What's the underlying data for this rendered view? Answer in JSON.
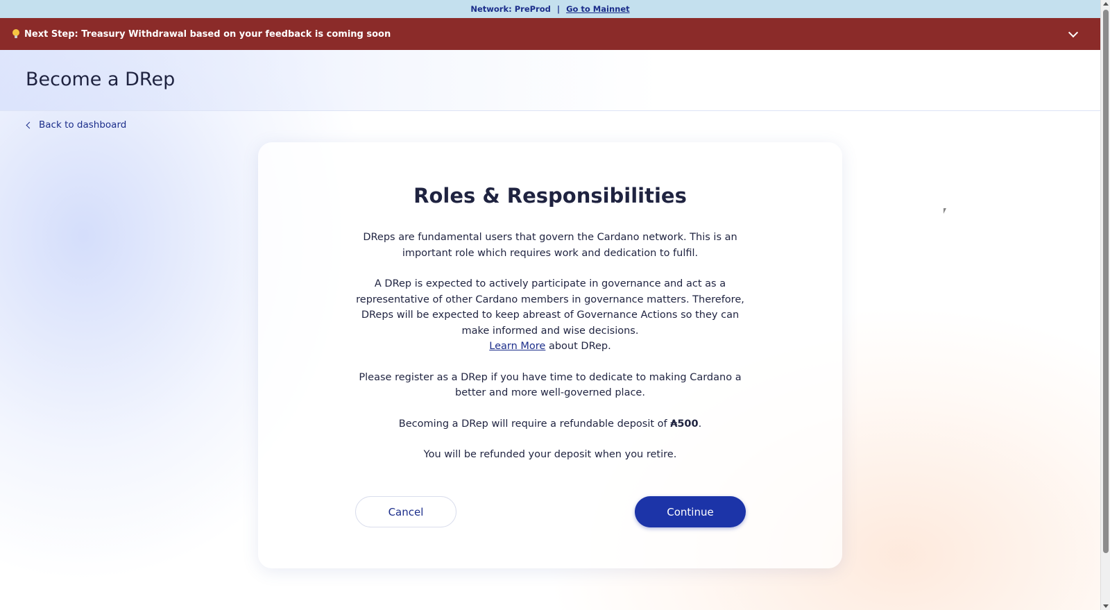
{
  "network_bar": {
    "label": "Network: PreProd",
    "separator": "|",
    "link": "Go to Mainnet"
  },
  "banner": {
    "icon": "lightbulb-icon",
    "text": "Next Step: Treasury Withdrawal based on your feedback is coming soon",
    "toggle_icon": "chevron-down-icon"
  },
  "header": {
    "title": "Become a DRep"
  },
  "nav": {
    "back_label": "Back to dashboard"
  },
  "card": {
    "title": "Roles & Responsibilities",
    "para1": "DReps are fundamental users that govern the Cardano network. This is an important role which requires work and dedication to fulfil.",
    "para2": "A DRep is expected to actively participate in governance and act as a representative of other Cardano members in governance matters. Therefore, DReps will be expected to keep abreast of Governance Actions so they can make informed and wise decisions.",
    "learn_more_link": "Learn More",
    "learn_more_suffix": " about DRep.",
    "para3": "Please register as a DRep if you have time to dedicate to making Cardano a better and more well-governed place.",
    "deposit_prefix": "Becoming a DRep will require a refundable deposit of ",
    "deposit_amount": "₳500",
    "deposit_suffix": ".",
    "para5": "You will be refunded your deposit when you retire.",
    "cancel_label": "Cancel",
    "continue_label": "Continue"
  },
  "colors": {
    "network_bar_bg": "#c4e0ee",
    "banner_bg": "#8b2b29",
    "primary": "#1c34a8",
    "text": "#1f2340"
  }
}
